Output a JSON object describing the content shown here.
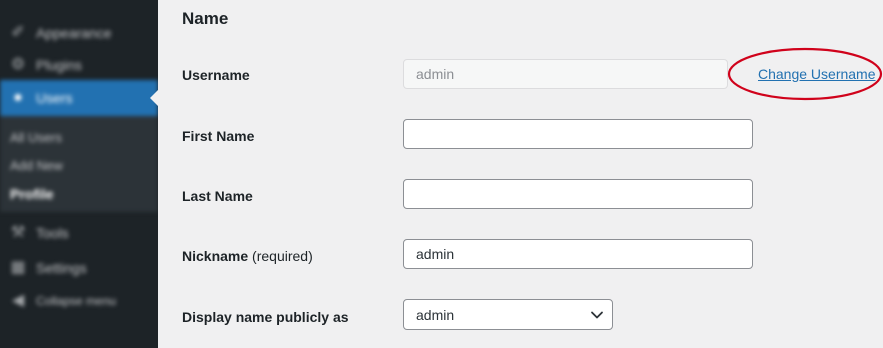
{
  "sidebar": {
    "items": [
      {
        "label": "Appearance",
        "icon": "paintbrush-icon"
      },
      {
        "label": "Plugins",
        "icon": "plugin-icon"
      },
      {
        "label": "Users",
        "icon": "user-icon"
      },
      {
        "label": "Tools",
        "icon": "wrench-icon"
      },
      {
        "label": "Settings",
        "icon": "settings-icon"
      },
      {
        "label": "Collapse menu",
        "icon": "collapse-icon"
      }
    ],
    "submenu": [
      {
        "label": "All Users"
      },
      {
        "label": "Add New"
      },
      {
        "label": "Profile"
      }
    ]
  },
  "main": {
    "section_title": "Name",
    "username": {
      "label": "Username",
      "value": "admin",
      "change_link": "Change Username"
    },
    "first_name": {
      "label": "First Name",
      "value": ""
    },
    "last_name": {
      "label": "Last Name",
      "value": ""
    },
    "nickname": {
      "label": "Nickname",
      "label_suffix": "(required)",
      "value": "admin"
    },
    "display_name": {
      "label": "Display name publicly as",
      "selected": "admin"
    }
  },
  "colors": {
    "accent": "#2271b1",
    "highlight_circle": "#d0021b"
  }
}
